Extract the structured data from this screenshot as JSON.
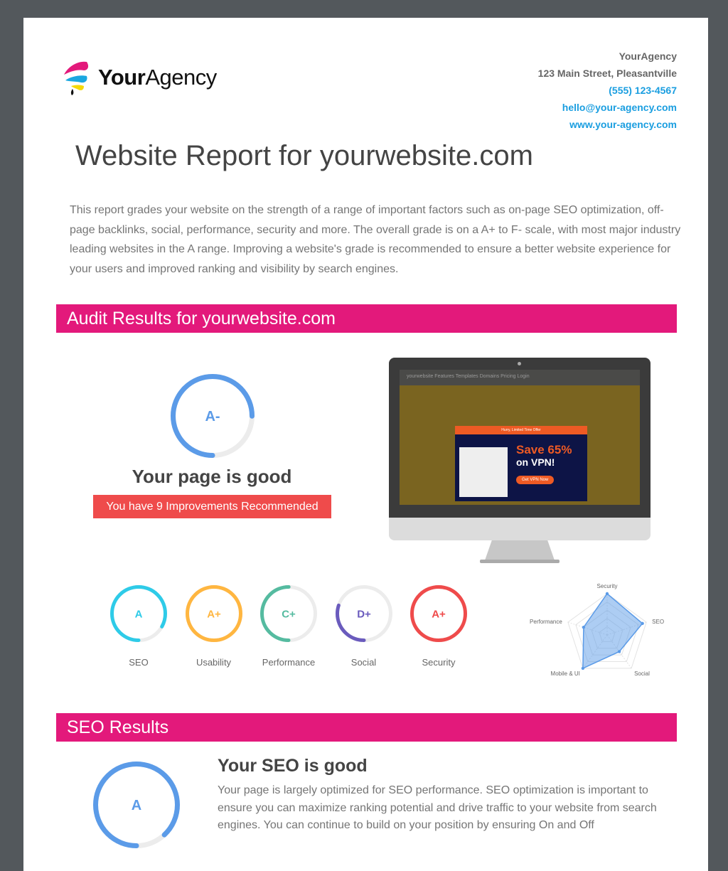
{
  "header": {
    "logo": {
      "bold": "Your",
      "regular": "Agency",
      "colors": [
        "#e3197b",
        "#1aa7e0",
        "#f5d90a"
      ]
    },
    "contact": {
      "name": "YourAgency",
      "address": "123 Main Street, Pleasantville",
      "phone": "(555) 123-4567",
      "email": "hello@your-agency.com",
      "website": "www.your-agency.com"
    }
  },
  "title": "Website Report for yourwebsite.com",
  "intro": "This report grades your website on the strength of a range of important factors such as on-page SEO optimization, off-page backlinks, social, performance, security and more. The overall grade is on a A+ to F- scale, with most major industry leading websites in the A range. Improving a website's grade is recommended to ensure a better website experience for your users and improved ranking and visibility by search engines.",
  "audit": {
    "heading": "Audit Results for yourwebsite.com",
    "overall": {
      "grade": "A-",
      "percent": 75,
      "color": "#5b9be8"
    },
    "status": "Your page is good",
    "improvements": "You have 9 Improvements Recommended",
    "preview": {
      "nav": "yourwebsite   Features   Templates   Domains   Pricing   Login",
      "offer": "Hurry, Limited Time Offer",
      "save": "Save 65%",
      "vpn": "on VPN!",
      "cta": "Get VPN Now"
    },
    "scores": [
      {
        "label": "SEO",
        "grade": "A",
        "percent": 83,
        "color": "#2ecbe8"
      },
      {
        "label": "Usability",
        "grade": "A+",
        "percent": 100,
        "color": "#ffb640"
      },
      {
        "label": "Performance",
        "grade": "C+",
        "percent": 50,
        "color": "#55bba0"
      },
      {
        "label": "Social",
        "grade": "D+",
        "percent": 30,
        "color": "#6a5bbd"
      },
      {
        "label": "Security",
        "grade": "A+",
        "percent": 100,
        "color": "#ef4b4b"
      }
    ],
    "chart_data": {
      "type": "radar",
      "axes": [
        "Security",
        "SEO",
        "Social",
        "Mobile & UI",
        "Performance"
      ],
      "values": [
        1.0,
        0.9,
        0.5,
        1.0,
        0.6
      ],
      "range": [
        0,
        1
      ],
      "color": "#5b9be8"
    }
  },
  "seo": {
    "heading": "SEO Results",
    "grade": "A",
    "percent": 88,
    "color": "#5b9be8",
    "title": "Your SEO is good",
    "text": "Your page is largely optimized for SEO performance. SEO optimization is important to ensure you can maximize ranking potential and drive traffic to your website from search engines. You can continue to build on your position by ensuring On and Off"
  }
}
